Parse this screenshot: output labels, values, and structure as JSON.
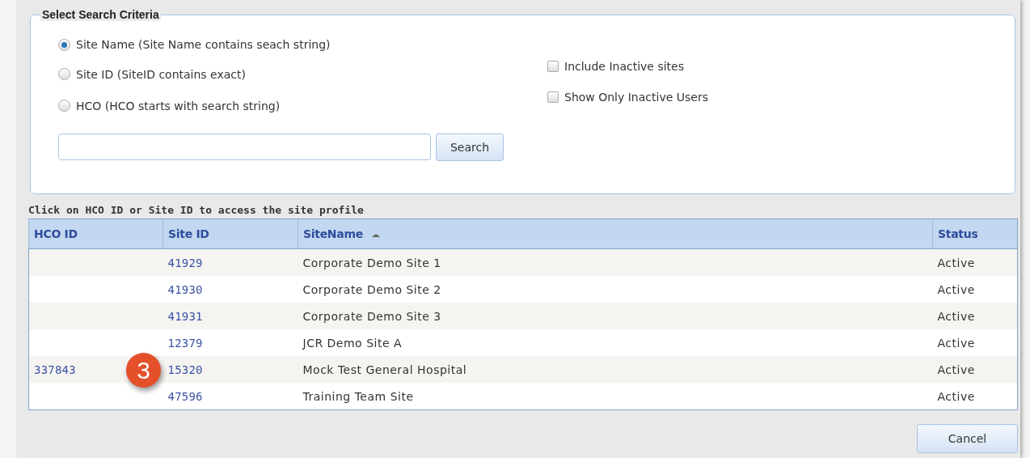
{
  "criteria": {
    "legend": "Select Search Criteria",
    "options": [
      {
        "label": "Site Name (Site Name contains seach string)",
        "selected": true
      },
      {
        "label": "Site ID (SiteID contains exact)",
        "selected": false
      },
      {
        "label": "HCO (HCO starts with search string)",
        "selected": false
      }
    ],
    "checkboxes": [
      {
        "label": "Include Inactive sites",
        "checked": false
      },
      {
        "label": "Show Only Inactive Users",
        "checked": false
      }
    ],
    "search_button": "Search"
  },
  "hint": "Click on HCO ID or Site ID to access the site profile",
  "table": {
    "columns": [
      {
        "label": "HCO ID",
        "sorted": false
      },
      {
        "label": "Site ID",
        "sorted": false
      },
      {
        "label": "SiteName",
        "sorted": true
      },
      {
        "label": "Status",
        "sorted": false
      }
    ],
    "rows": [
      {
        "hco_id": "",
        "site_id": "41929",
        "site_name": "Corporate Demo Site 1",
        "status": "Active"
      },
      {
        "hco_id": "",
        "site_id": "41930",
        "site_name": "Corporate Demo Site 2",
        "status": "Active"
      },
      {
        "hco_id": "",
        "site_id": "41931",
        "site_name": "Corporate Demo Site 3",
        "status": "Active"
      },
      {
        "hco_id": "",
        "site_id": "12379",
        "site_name": "JCR Demo Site A",
        "status": "Active"
      },
      {
        "hco_id": "337843",
        "site_id": "15320",
        "site_name": "Mock Test General Hospital",
        "status": "Active"
      },
      {
        "hco_id": "",
        "site_id": "47596",
        "site_name": "Training Team Site",
        "status": "Active"
      }
    ]
  },
  "step_badge": "3",
  "cancel_button": "Cancel"
}
